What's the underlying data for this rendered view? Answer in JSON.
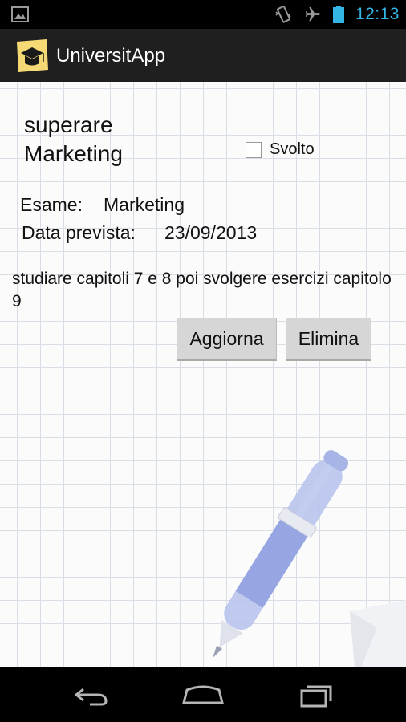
{
  "status_bar": {
    "time": "12:13",
    "icons": [
      "image-notification-icon",
      "vibrate-icon",
      "airplane-mode-icon",
      "battery-icon"
    ],
    "accent_color": "#33b5e5"
  },
  "action_bar": {
    "app_title": "UniversitApp",
    "logo_icon": "graduation-cap-icon"
  },
  "goal": {
    "title": "superare Marketing",
    "done_label": "Svolto",
    "done_checked": false
  },
  "details": {
    "exam_label": "Esame:",
    "exam_value": "Marketing",
    "date_label": "Data prevista:",
    "date_value": "23/09/2013"
  },
  "description": "studiare capitoli 7 e 8 poi svolgere esercizi capitolo 9",
  "buttons": {
    "update_label": "Aggiorna",
    "delete_label": "Elimina"
  },
  "nav_bar": {
    "icons": [
      "back-icon",
      "home-icon",
      "recent-apps-icon"
    ]
  }
}
